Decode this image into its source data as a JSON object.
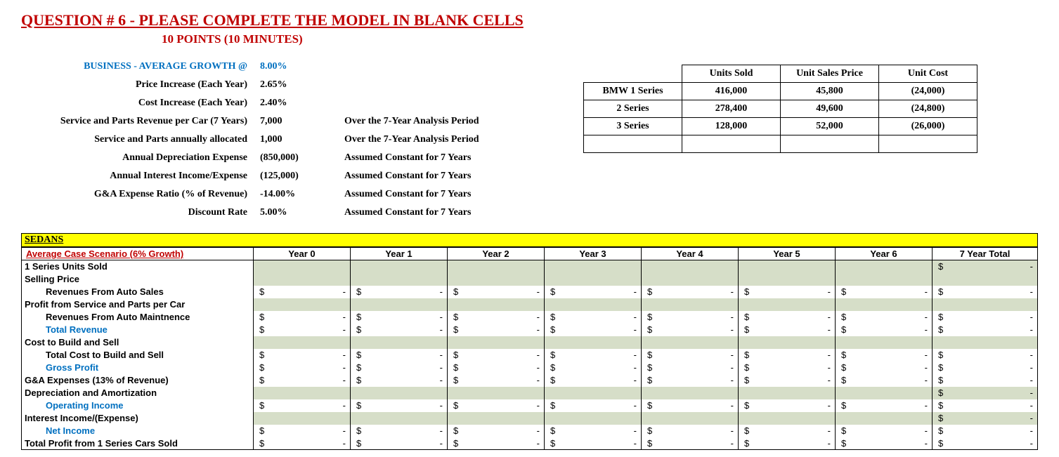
{
  "title": "QUESTION # 6 - PLEASE COMPLETE THE MODEL IN BLANK CELLS",
  "subtitle": "10 POINTS  (10 MINUTES)",
  "assumptions": [
    {
      "label": "BUSINESS - AVERAGE GROWTH @",
      "value": "8.00%",
      "note": "",
      "labelClass": "blue-label",
      "valClass": "blue-val"
    },
    {
      "label": "Price Increase (Each Year)",
      "value": "2.65%",
      "note": ""
    },
    {
      "label": "Cost Increase (Each Year)",
      "value": "2.40%",
      "note": ""
    },
    {
      "label": "Service and Parts Revenue per Car (7 Years)",
      "value": "7,000",
      "note": "Over the 7-Year Analysis Period"
    },
    {
      "label": "Service and Parts annually allocated",
      "value": "1,000",
      "note": "Over the 7-Year Analysis Period"
    },
    {
      "label": "Annual Depreciation Expense",
      "value": "(850,000)",
      "note": "Assumed Constant for 7 Years"
    },
    {
      "label": "Annual Interest Income/Expense",
      "value": "(125,000)",
      "note": "Assumed Constant for 7 Years"
    },
    {
      "label": "G&A Expense Ratio (% of Revenue)",
      "value": "-14.00%",
      "note": "Assumed Constant for 7 Years"
    },
    {
      "label": "Discount Rate",
      "value": "5.00%",
      "note": "Assumed Constant for 7 Years"
    }
  ],
  "seriesHeaders": [
    "",
    "Units Sold",
    "Unit Sales Price",
    "Unit Cost"
  ],
  "seriesRows": [
    {
      "name": "BMW 1 Series",
      "units": "416,000",
      "price": "45,800",
      "cost": "(24,000)"
    },
    {
      "name": "2 Series",
      "units": "278,400",
      "price": "49,600",
      "cost": "(24,800)"
    },
    {
      "name": "3 Series",
      "units": "128,000",
      "price": "52,000",
      "cost": "(26,000)"
    }
  ],
  "sedansLabel": "SEDANS",
  "scenarioLabel": "Average Case Scenario (6% Growth)",
  "yearHeaders": [
    "Year 0",
    "Year 1",
    "Year 2",
    "Year 3",
    "Year 4",
    "Year 5",
    "Year 6",
    "7 Year Total"
  ],
  "rows": [
    {
      "label": "1 Series Units Sold",
      "type": "label",
      "shade": true,
      "dash": false,
      "totOnly": true
    },
    {
      "label": "Selling Price",
      "type": "label",
      "shade": true,
      "dash": false,
      "totOnly": false,
      "noTotal": true
    },
    {
      "label": "Revenues From Auto Sales",
      "type": "sub",
      "shade": false,
      "dash": true
    },
    {
      "label": "Profit from Service and Parts per Car",
      "type": "label",
      "shade": true,
      "dash": false,
      "noTotal": true
    },
    {
      "label": "Revenues From Auto Maintnence",
      "type": "sub",
      "shade": false,
      "dash": true
    },
    {
      "label": "Total Revenue",
      "type": "sub-blue",
      "shade": false,
      "dash": true
    },
    {
      "label": "Cost to Build and Sell",
      "type": "label",
      "shade": true,
      "dash": false,
      "noTotal": true
    },
    {
      "label": "Total Cost to Build and Sell",
      "type": "sub",
      "shade": false,
      "dash": true
    },
    {
      "label": "Gross Profit",
      "type": "sub-blue",
      "shade": false,
      "dash": true
    },
    {
      "label": "G&A Expenses (13% of Revenue)",
      "type": "label",
      "shade": false,
      "dash": true
    },
    {
      "label": "Depreciation and Amortization",
      "type": "label",
      "shade": true,
      "dash": false,
      "totOnly": true
    },
    {
      "label": "Operating Income",
      "type": "sub-blue",
      "shade": false,
      "dash": true
    },
    {
      "label": "Interest Income/(Expense)",
      "type": "label",
      "shade": true,
      "dash": false,
      "totOnly": true
    },
    {
      "label": "Net Income",
      "type": "sub-blue",
      "shade": false,
      "dash": true
    },
    {
      "label": "Total Profit from 1 Series Cars Sold",
      "type": "label",
      "shade": false,
      "dash": true
    }
  ],
  "dashVal": "-"
}
